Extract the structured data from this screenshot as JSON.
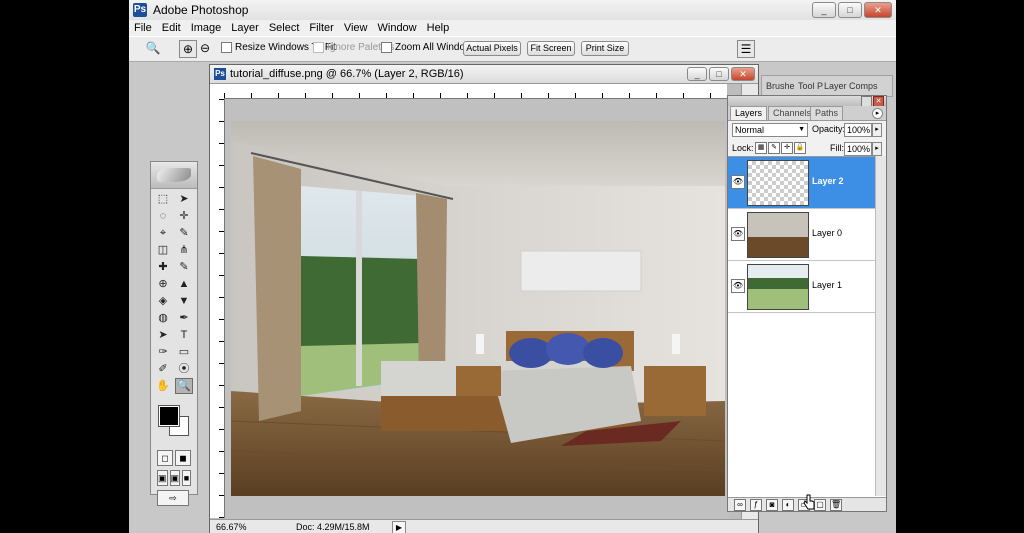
{
  "app": {
    "title": "Adobe Photoshop",
    "logo_icon": "ps-logo-icon",
    "window_buttons": [
      "_",
      "□",
      "✕"
    ]
  },
  "menu": {
    "items": [
      "File",
      "Edit",
      "Image",
      "Layer",
      "Select",
      "Filter",
      "View",
      "Window",
      "Help"
    ]
  },
  "options": {
    "resize_windows": "Resize Windows To Fit",
    "ignore_palettes": "Ignore Palettes",
    "zoom_all": "Zoom All Windows",
    "actual_pixels": "Actual Pixels",
    "fit_screen": "Fit Screen",
    "print_size": "Print Size",
    "palette_well": [
      "Brushe",
      "Tool P",
      "Layer Comps"
    ]
  },
  "toolbox": {
    "tools": [
      "⬚",
      "➤",
      "◌",
      "✛",
      "⌖",
      "✎",
      "◫",
      "⋔",
      "✚",
      "✎",
      "⊕",
      "▲",
      "◈",
      "▼",
      "◍",
      "✒",
      "➤",
      "T",
      "✑",
      "▭",
      "✐",
      "⦿",
      "✋",
      "🔍"
    ]
  },
  "document": {
    "title": "tutorial_diffuse.png @ 66.7% (Layer 2, RGB/16)",
    "zoom": "66.67%",
    "doc_size": "Doc: 4.29M/15.8M",
    "status_arrow": "▶"
  },
  "layers_palette": {
    "tabs": [
      "Layers",
      "Channels",
      "Paths"
    ],
    "blend_mode": "Normal",
    "opacity_label": "Opacity:",
    "opacity": "100%",
    "lock_label": "Lock:",
    "fill_label": "Fill:",
    "fill": "100%",
    "layers": [
      {
        "name": "Layer 2",
        "selected": true
      },
      {
        "name": "Layer 0",
        "selected": false
      },
      {
        "name": "Layer 1",
        "selected": false
      }
    ]
  }
}
